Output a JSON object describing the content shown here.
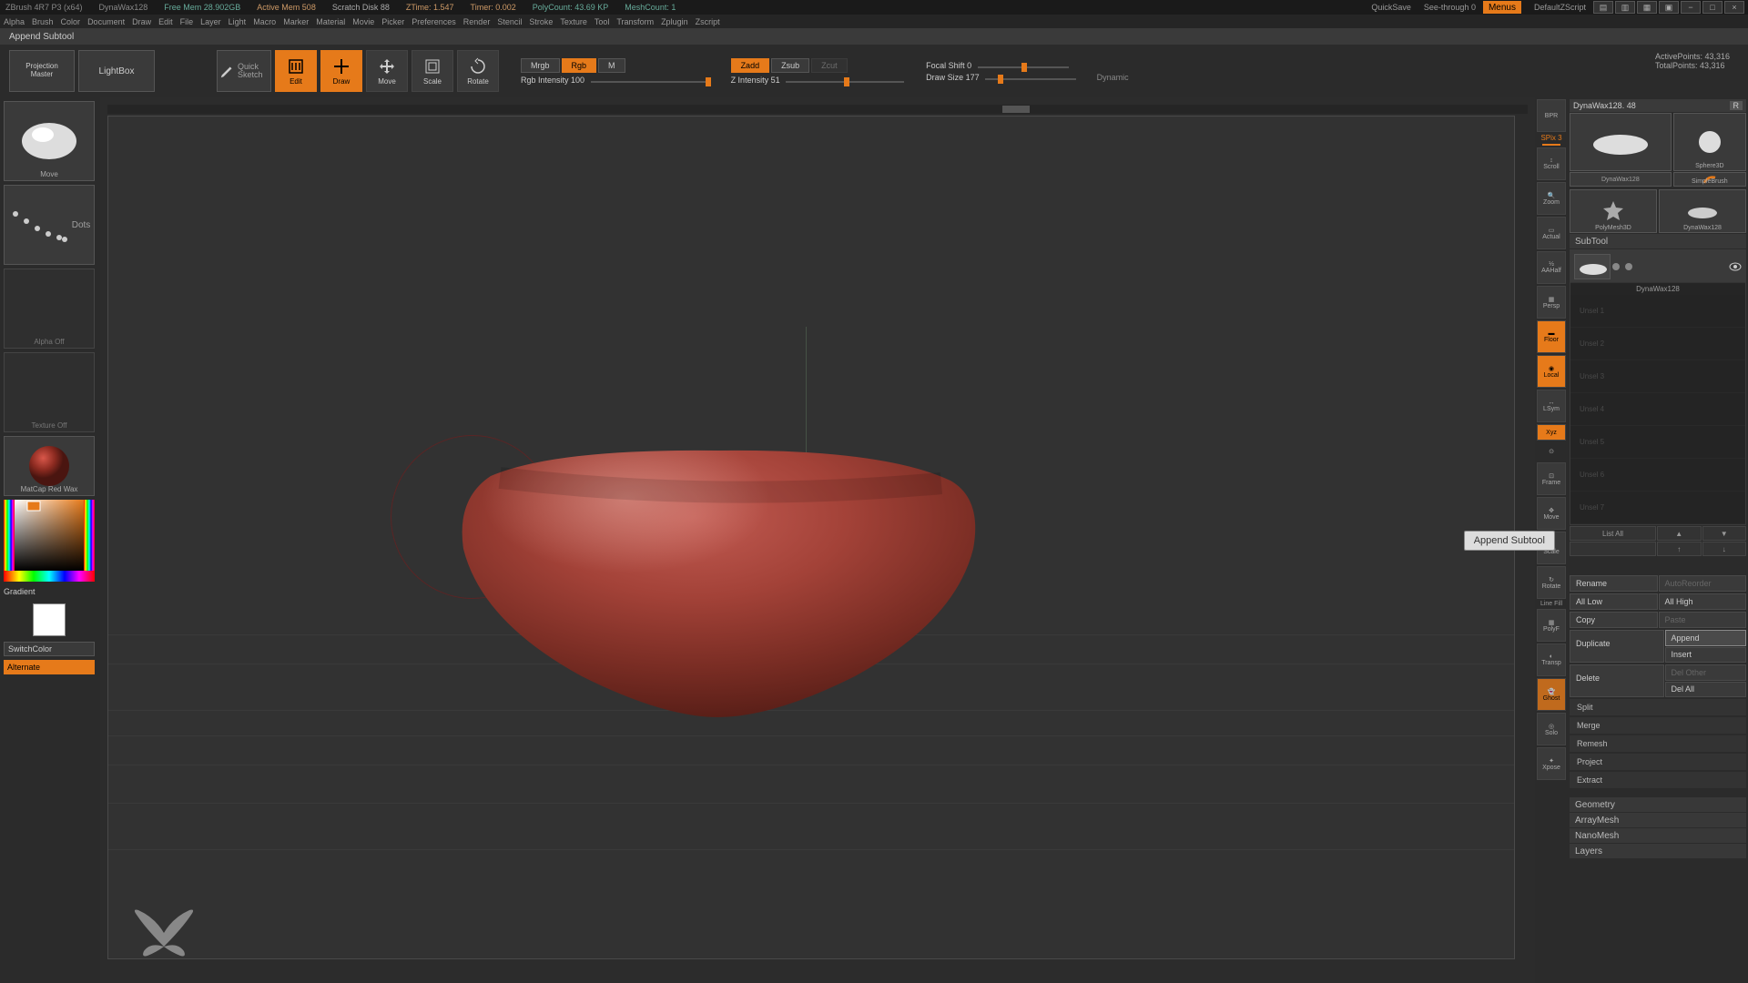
{
  "titlebar": {
    "app": "ZBrush 4R7 P3 (x64)",
    "file": "DynaWax128",
    "free_mem": "Free Mem 28.902GB",
    "active_mem": "Active Mem 508",
    "scratch": "Scratch Disk 88",
    "ztime": "ZTime: 1.547",
    "timer": "Timer: 0.002",
    "polycount": "PolyCount: 43.69 KP",
    "meshcount": "MeshCount: 1",
    "quicksave": "QuickSave",
    "seethrough": "See-through  0",
    "menus": "Menus",
    "script": "DefaultZScript"
  },
  "menubar": [
    "Alpha",
    "Brush",
    "Color",
    "Document",
    "Draw",
    "Edit",
    "File",
    "Layer",
    "Light",
    "Macro",
    "Marker",
    "Material",
    "Movie",
    "Picker",
    "Preferences",
    "Render",
    "Stencil",
    "Stroke",
    "Texture",
    "Tool",
    "Transform",
    "Zplugin",
    "Zscript"
  ],
  "actionbar": {
    "text": "Append Subtool"
  },
  "toolrow": {
    "projection": "Projection\nMaster",
    "lightbox": "LightBox",
    "quicksketch": "Quick Sketch",
    "edit": "Edit",
    "draw": "Draw",
    "move": "Move",
    "scale": "Scale",
    "rotate": "Rotate",
    "mrgb": "Mrgb",
    "rgb": "Rgb",
    "m": "M",
    "zadd": "Zadd",
    "zsub": "Zsub",
    "zcut": "Zcut",
    "rgb_intensity": "Rgb Intensity 100",
    "z_intensity": "Z Intensity 51",
    "focal_shift": "Focal Shift 0",
    "draw_size": "Draw Size 177",
    "dynamic": "Dynamic",
    "active_pts": "ActivePoints: 43,316",
    "total_pts": "TotalPoints: 43,316"
  },
  "left": {
    "brush_name": "Move",
    "stroke_name": "Dots",
    "alpha_off": "Alpha Off",
    "texture_off": "Texture Off",
    "material": "MatCap Red Wax",
    "gradient": "Gradient",
    "switchcolor": "SwitchColor",
    "alternate": "Alternate"
  },
  "rightmini": {
    "spix": "SPix 3",
    "items": [
      "BPR",
      "Scroll",
      "Zoom",
      "Actual",
      "AAHalf",
      "Persp",
      "Floor",
      "Local",
      "LSym",
      "Xyz",
      "",
      "Frame",
      "Move",
      "Scale",
      "Rotate",
      "Line Fill",
      "PolyF",
      "Transp",
      "Ghost",
      "Solo",
      "Xpose"
    ]
  },
  "rightpanel": {
    "tool_name": "DynaWax128. 48",
    "r": "R",
    "tools": [
      {
        "name": "DynaWax128"
      },
      {
        "name": "Sphere3D"
      },
      {
        "name": "SimpleBrush"
      },
      {
        "name": "PolyMesh3D"
      },
      {
        "name": "DynaWax128"
      }
    ],
    "subtool_header": "SubTool",
    "subtool_active": "DynaWax128",
    "subtool_slots": [
      "Unsel 1",
      "Unsel 2",
      "Unsel 3",
      "Unsel 4",
      "Unsel 5",
      "Unsel 6",
      "Unsel 7"
    ],
    "list_all": "List All",
    "rename": "Rename",
    "autoreorder": "AutoReorder",
    "all_low": "All Low",
    "all_high": "All High",
    "copy": "Copy",
    "paste": "Paste",
    "duplicate": "Duplicate",
    "append": "Append",
    "insert": "Insert",
    "delete": "Delete",
    "del_other": "Del Other",
    "del_all": "Del All",
    "collapsibles": [
      "Split",
      "Merge",
      "Remesh",
      "Project",
      "Extract"
    ],
    "bottom_sections": [
      "Geometry",
      "ArrayMesh",
      "NanoMesh",
      "Layers"
    ]
  },
  "tooltip": "Append Subtool"
}
